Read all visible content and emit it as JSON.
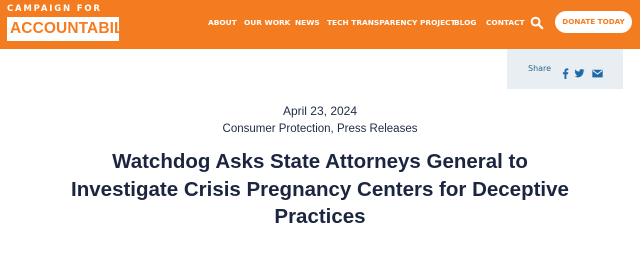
{
  "brand": {
    "top_line": "CAMPAIGN FOR",
    "main_line": "ACCOUNTABILITY",
    "colors": {
      "accent": "#f47c20",
      "text_dark": "#1c2540",
      "share_bg": "#e9eef3",
      "share_blue": "#1e6aa8"
    }
  },
  "nav": {
    "items": [
      {
        "label": "ABOUT"
      },
      {
        "label": "OUR WORK"
      },
      {
        "label": "NEWS"
      },
      {
        "label": "TECH TRANSPARENCY PROJECT"
      },
      {
        "label": "BLOG"
      },
      {
        "label": "CONTACT"
      }
    ],
    "search_icon": "search-icon",
    "donate_label": "DONATE TODAY"
  },
  "share": {
    "label": "Share",
    "icons": [
      "facebook-icon",
      "twitter-icon",
      "email-icon"
    ]
  },
  "article": {
    "date": "April 23, 2024",
    "categories": [
      "Consumer Protection",
      "Press Releases"
    ],
    "category_separator": ", ",
    "title": "Watchdog Asks State Attorneys General to Investigate Crisis Pregnancy Centers for Deceptive Practices"
  }
}
